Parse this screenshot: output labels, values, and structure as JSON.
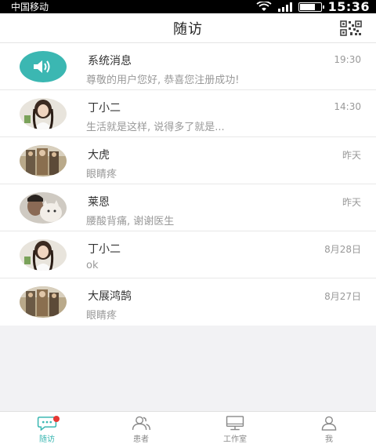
{
  "status_bar": {
    "carrier": "中国移动",
    "time": "15:36",
    "battery_level": 0.7
  },
  "header": {
    "title": "随访",
    "qr_icon": "qr-code-icon"
  },
  "conversations": [
    {
      "name": "系统消息",
      "time": "19:30",
      "message": "尊敬的用户您好, 恭喜您注册成功!",
      "avatar": "speaker-icon"
    },
    {
      "name": "丁小二",
      "time": "14:30",
      "message": "生活就是这样, 说得多了就是...",
      "avatar": "photo-avatar"
    },
    {
      "name": "大虎",
      "time": "昨天",
      "message": "眼睛疼",
      "avatar": "photo-avatar"
    },
    {
      "name": "莱恩",
      "time": "昨天",
      "message": "腰酸背痛, 谢谢医生",
      "avatar": "photo-avatar"
    },
    {
      "name": "丁小二",
      "time": "8月28日",
      "message": "ok",
      "avatar": "photo-avatar"
    },
    {
      "name": "大展鸿鹄",
      "time": "8月27日",
      "message": "眼睛疼",
      "avatar": "photo-avatar"
    }
  ],
  "tabs": [
    {
      "label": "随访",
      "icon": "chat-bubble-icon",
      "active": true,
      "badge": true
    },
    {
      "label": "患者",
      "icon": "users-icon",
      "active": false
    },
    {
      "label": "工作室",
      "icon": "monitor-icon",
      "active": false
    },
    {
      "label": "我",
      "icon": "person-icon",
      "active": false
    }
  ],
  "colors": {
    "accent": "#3bb7b2",
    "badge": "#e53935",
    "background": "#f2f2f4"
  }
}
